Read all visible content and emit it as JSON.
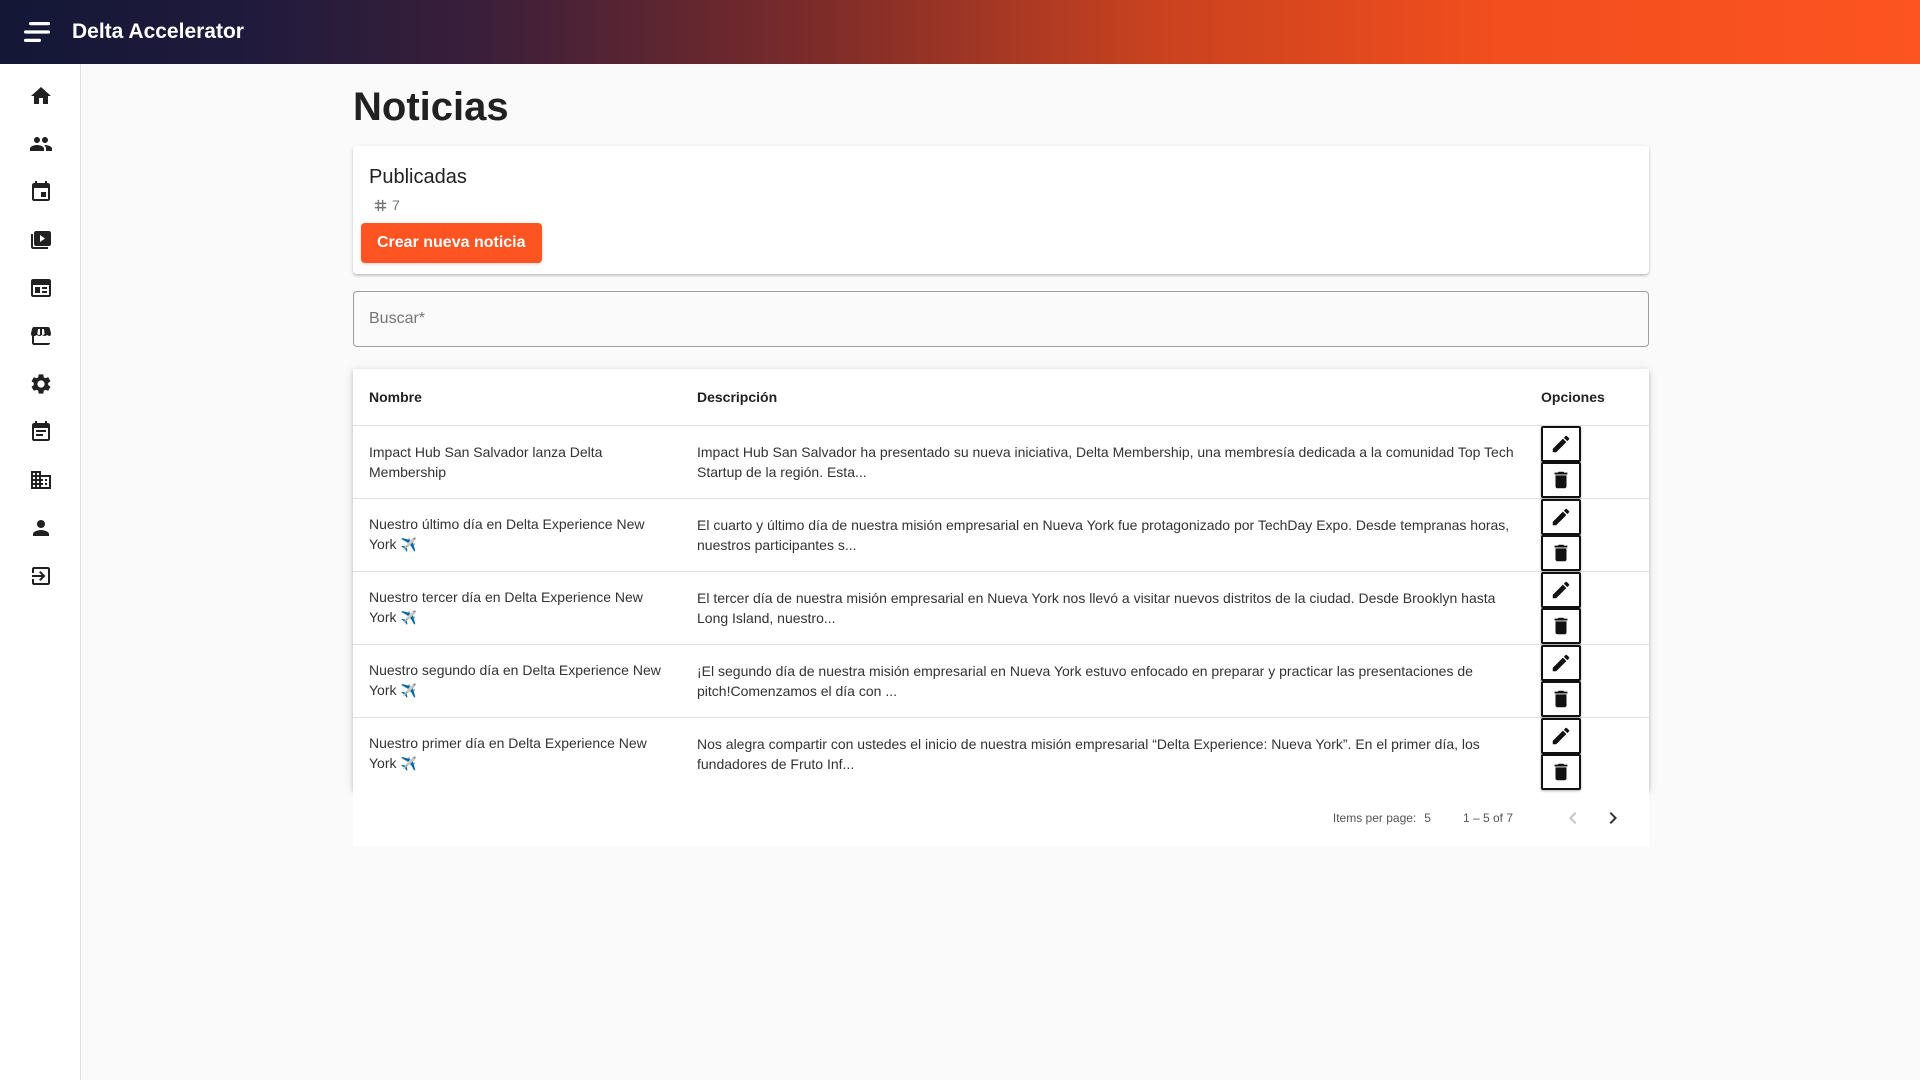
{
  "app": {
    "title": "Delta Accelerator"
  },
  "sidebar": {
    "items": [
      {
        "icon": "home-icon"
      },
      {
        "icon": "people-icon"
      },
      {
        "icon": "calendar-event-icon"
      },
      {
        "icon": "video-library-icon"
      },
      {
        "icon": "newspaper-icon"
      },
      {
        "icon": "store-icon"
      },
      {
        "icon": "gear-icon"
      },
      {
        "icon": "event-note-icon"
      },
      {
        "icon": "domain-icon"
      },
      {
        "icon": "person-icon"
      },
      {
        "icon": "logout-icon"
      }
    ]
  },
  "page": {
    "title": "Noticias"
  },
  "published": {
    "label": "Publicadas",
    "count": "7",
    "create_label": "Crear nueva noticia"
  },
  "search": {
    "placeholder": "Buscar*"
  },
  "table": {
    "headers": {
      "name": "Nombre",
      "description": "Descripción",
      "options": "Opciones"
    },
    "rows": [
      {
        "name": "Impact Hub San Salvador lanza Delta Membership",
        "plane": "",
        "description": "Impact Hub San Salvador ha presentado su nueva iniciativa, Delta Membership, una membresía dedicada a la comunidad Top Tech Startup de la región. Esta..."
      },
      {
        "name": "Nuestro último día en Delta Experience New York",
        "plane": "✈️",
        "description": "El cuarto y último día de nuestra misión empresarial en Nueva York fue protagonizado por TechDay Expo. Desde tempranas horas, nuestros participantes s..."
      },
      {
        "name": "Nuestro tercer día en Delta Experience New York",
        "plane": "✈️",
        "description": "El tercer día de nuestra misión empresarial en Nueva York nos llevó a visitar nuevos distritos de la ciudad. Desde Brooklyn hasta Long Island, nuestro..."
      },
      {
        "name": "Nuestro segundo día en Delta Experience New York",
        "plane": "✈️",
        "description": "¡El segundo día de nuestra misión empresarial en Nueva York estuvo enfocado en preparar y practicar las presentaciones de pitch!Comenzamos el día con ..."
      },
      {
        "name": "Nuestro primer día en Delta Experience New York",
        "plane": "✈️",
        "description": "Nos alegra compartir con ustedes el inicio de nuestra misión empresarial “Delta Experience: Nueva York”. En el primer día, los fundadores de Fruto Inf..."
      }
    ]
  },
  "paginator": {
    "items_per_page_label": "Items per page:",
    "items_per_page": "5",
    "range": "1 – 5 of 7"
  }
}
